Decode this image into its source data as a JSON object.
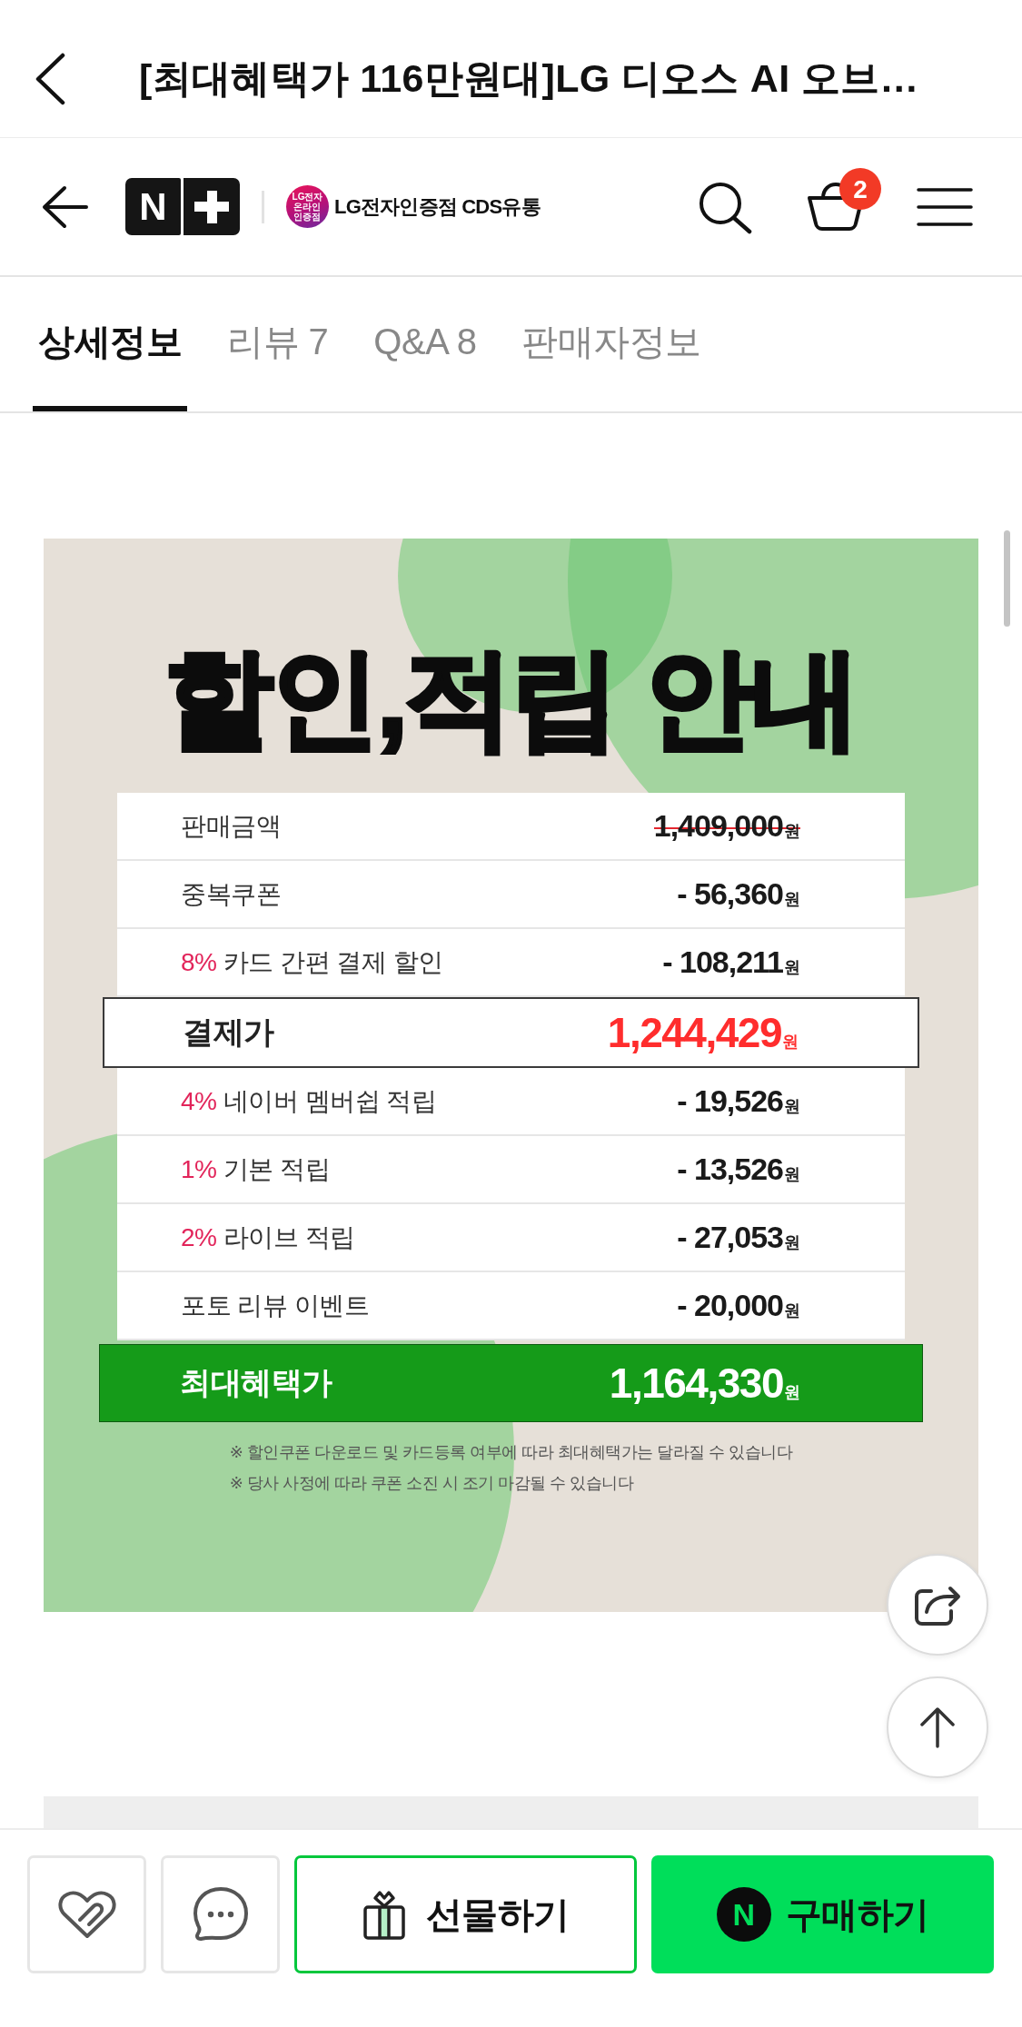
{
  "top_bar": {
    "title": "[최대혜택가 116만원대]LG 디오스 AI 오브…"
  },
  "store_bar": {
    "logo_letter": "N",
    "store_badge": [
      "LG전자",
      "온라인",
      "인증점"
    ],
    "store_name": "LG전자인증점 CDS유통",
    "cart_count": "2"
  },
  "tabs": [
    {
      "label": "상세정보",
      "selected": true
    },
    {
      "label": "리뷰 7",
      "selected": false
    },
    {
      "label": "Q&A 8",
      "selected": false
    },
    {
      "label": "판매자정보",
      "selected": false
    }
  ],
  "banner": {
    "title": "할인,적립 안내",
    "rows": [
      {
        "kind": "item",
        "label": "판매금액",
        "amount": "1,409,000",
        "unit": "원",
        "struck": true
      },
      {
        "kind": "item",
        "label": "중복쿠폰",
        "amount": "- 56,360",
        "unit": "원",
        "struck": false
      },
      {
        "kind": "item",
        "rate": "8%",
        "label": "카드 간편 결제 할인",
        "amount": "- 108,211",
        "unit": "원",
        "struck": false
      },
      {
        "kind": "highlight",
        "label": "결제가",
        "amount": "1,244,429",
        "unit": "원",
        "struck": false
      },
      {
        "kind": "item",
        "rate": "4%",
        "label": "네이버 멤버쉽 적립",
        "amount": "- 19,526",
        "unit": "원",
        "struck": false
      },
      {
        "kind": "item",
        "rate": "1%",
        "label": "기본 적립",
        "amount": "- 13,526",
        "unit": "원",
        "struck": false
      },
      {
        "kind": "item",
        "rate": "2%",
        "label": "라이브 적립",
        "amount": "- 27,053",
        "unit": "원",
        "struck": false
      },
      {
        "kind": "item",
        "label": "포토 리뷰 이벤트",
        "amount": "- 20,000",
        "unit": "원",
        "struck": false
      },
      {
        "kind": "total",
        "label": "최대혜택가",
        "amount": "1,164,330",
        "unit": "원",
        "struck": false
      }
    ],
    "notes": [
      "※ 할인쿠폰 다운로드 및 카드등록 여부에 따라 최대혜택가는 달라질 수 있습니다",
      "※ 당사 사정에 따라 쿠폰 소진 시 조기 마감될 수 있습니다"
    ]
  },
  "bottom_bar": {
    "gift_button": {
      "label": "선물하기"
    },
    "buy_button": {
      "logo_letter": "N",
      "label": "구매하기"
    }
  }
}
